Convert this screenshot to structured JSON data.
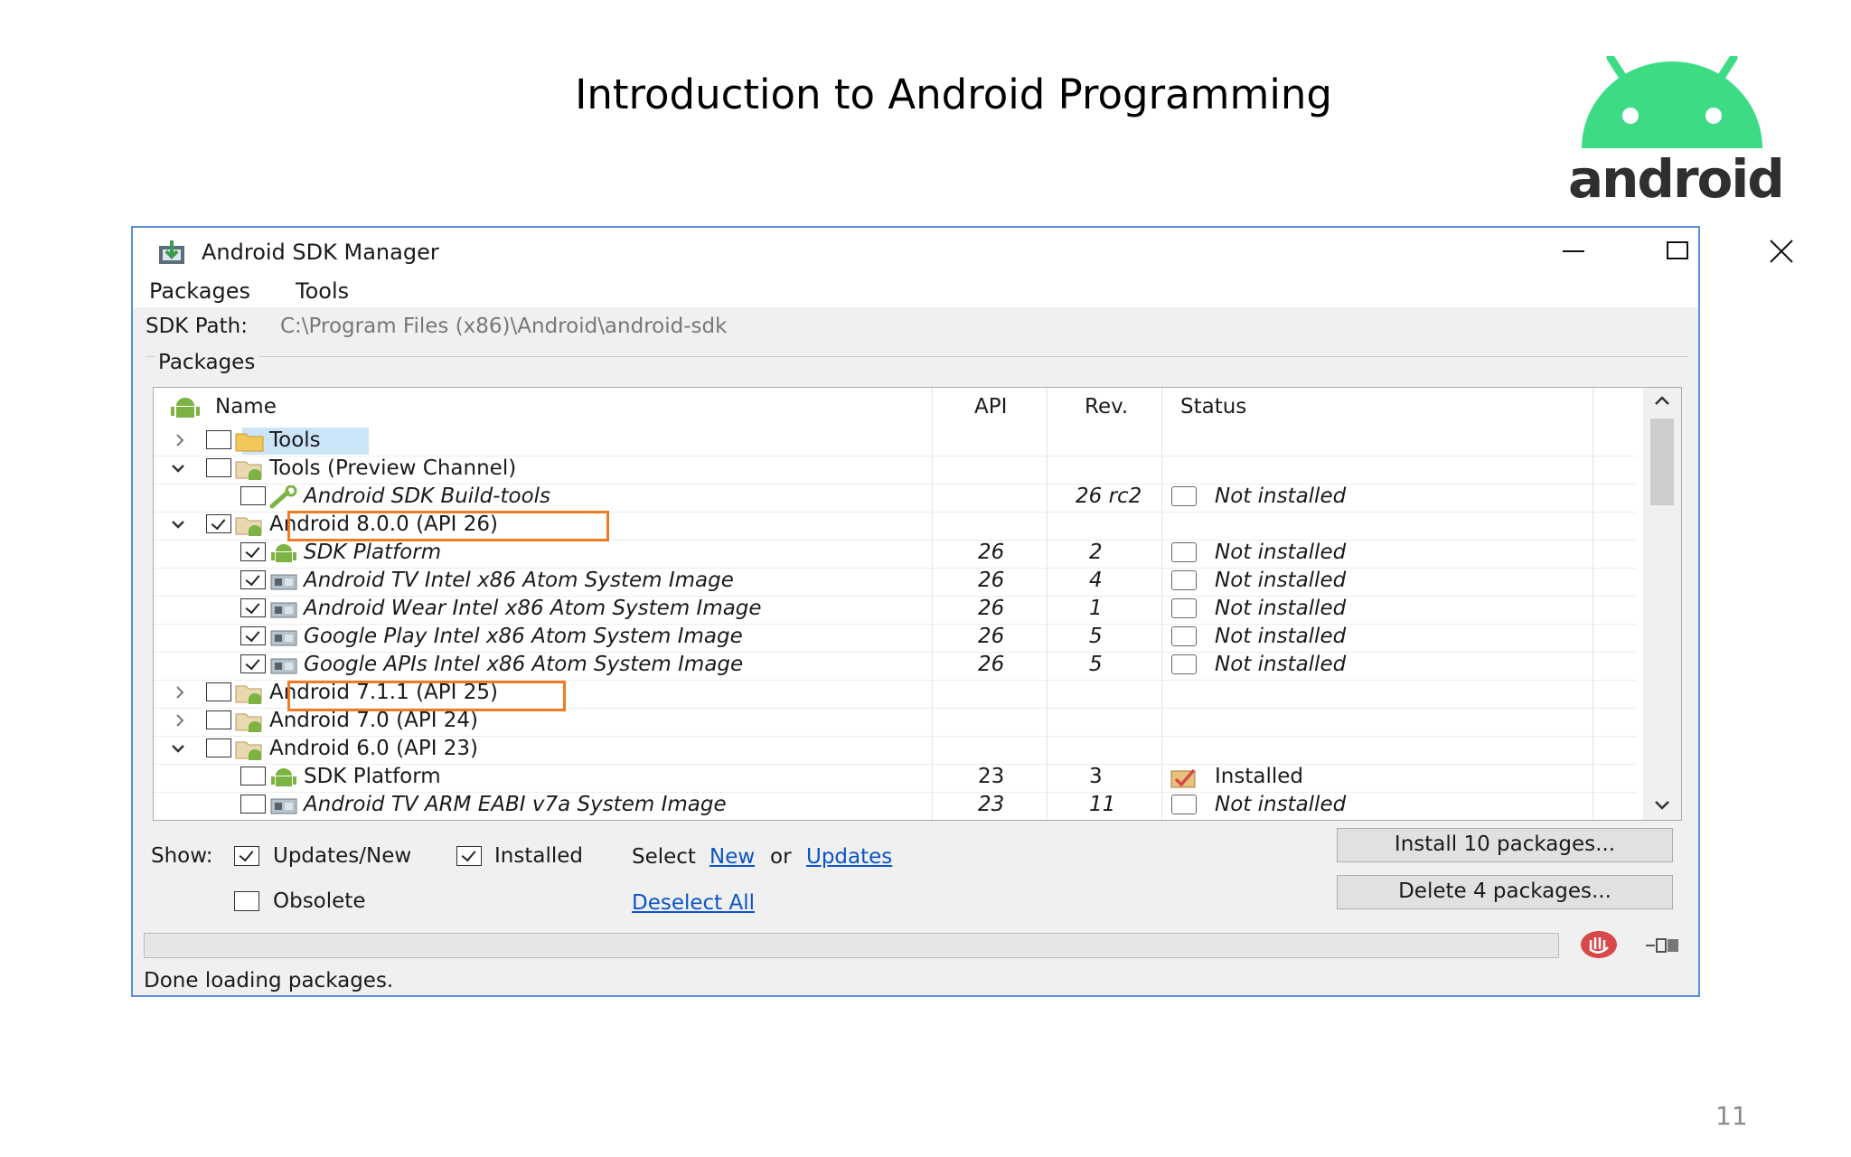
{
  "slide": {
    "title": "Introduction to Android Programming",
    "logo_word": "android",
    "page_number": "11",
    "brand_color": "#3ddc84"
  },
  "window": {
    "title": "Android SDK Manager",
    "menu": [
      "Packages",
      "Tools"
    ],
    "sdk_path_label": "SDK Path:",
    "sdk_path_value": "C:\\Program Files (x86)\\Android\\android-sdk",
    "group_label": "Packages",
    "highlight_color": "#f07b22"
  },
  "table": {
    "headers": {
      "name": "Name",
      "api": "API",
      "rev": "Rev.",
      "status": "Status"
    },
    "rows": [
      {
        "name": "Tools",
        "api": "",
        "rev": "",
        "status": "",
        "expander": "collapsed",
        "checked": false,
        "icon": "folder-icon",
        "italic": false
      },
      {
        "name": "Tools (Preview Channel)",
        "api": "",
        "rev": "",
        "status": "",
        "expander": "expanded",
        "checked": false,
        "icon": "folder-android-icon",
        "italic": false
      },
      {
        "name": "Android SDK Build-tools",
        "api": "",
        "rev": "26 rc2",
        "status": "Not installed",
        "expander": "none",
        "checked": false,
        "icon": "wrench-icon",
        "italic": true
      },
      {
        "name": "Android 8.0.0 (API 26)",
        "api": "",
        "rev": "",
        "status": "",
        "expander": "expanded",
        "checked": true,
        "icon": "folder-android-icon",
        "italic": false
      },
      {
        "name": "SDK Platform",
        "api": "26",
        "rev": "2",
        "status": "Not installed",
        "expander": "none",
        "checked": true,
        "icon": "android-robot-icon",
        "italic": true
      },
      {
        "name": "Android TV Intel x86 Atom System Image",
        "api": "26",
        "rev": "4",
        "status": "Not installed",
        "expander": "none",
        "checked": true,
        "icon": "system-image-icon",
        "italic": true
      },
      {
        "name": "Android Wear Intel x86 Atom System Image",
        "api": "26",
        "rev": "1",
        "status": "Not installed",
        "expander": "none",
        "checked": true,
        "icon": "system-image-icon",
        "italic": true
      },
      {
        "name": "Google Play Intel x86 Atom System Image",
        "api": "26",
        "rev": "5",
        "status": "Not installed",
        "expander": "none",
        "checked": true,
        "icon": "system-image-icon",
        "italic": true
      },
      {
        "name": "Google APIs Intel x86 Atom System Image",
        "api": "26",
        "rev": "5",
        "status": "Not installed",
        "expander": "none",
        "checked": true,
        "icon": "system-image-icon",
        "italic": true
      },
      {
        "name": "Android 7.1.1 (API 25)",
        "api": "",
        "rev": "",
        "status": "",
        "expander": "collapsed",
        "checked": false,
        "icon": "folder-android-icon",
        "italic": false
      },
      {
        "name": "Android 7.0 (API 24)",
        "api": "",
        "rev": "",
        "status": "",
        "expander": "collapsed",
        "checked": false,
        "icon": "folder-android-icon",
        "italic": false
      },
      {
        "name": "Android 6.0 (API 23)",
        "api": "",
        "rev": "",
        "status": "",
        "expander": "expanded",
        "checked": false,
        "icon": "folder-android-icon",
        "italic": false
      },
      {
        "name": "SDK Platform",
        "api": "23",
        "rev": "3",
        "status": "Installed",
        "expander": "none",
        "checked": false,
        "icon": "android-robot-icon",
        "italic": false
      },
      {
        "name": "Android TV ARM EABI v7a System Image",
        "api": "23",
        "rev": "11",
        "status": "Not installed",
        "expander": "none",
        "checked": false,
        "icon": "system-image-icon",
        "italic": true
      }
    ]
  },
  "footer": {
    "show_label": "Show:",
    "updates_new": "Updates/New",
    "installed": "Installed",
    "obsolete": "Obsolete",
    "select_prefix": "Select",
    "select_new": "New",
    "select_or": "or",
    "select_updates": "Updates",
    "deselect_all": "Deselect All",
    "install_button": "Install 10 packages...",
    "delete_button": "Delete 4 packages...",
    "status": "Done loading packages."
  }
}
